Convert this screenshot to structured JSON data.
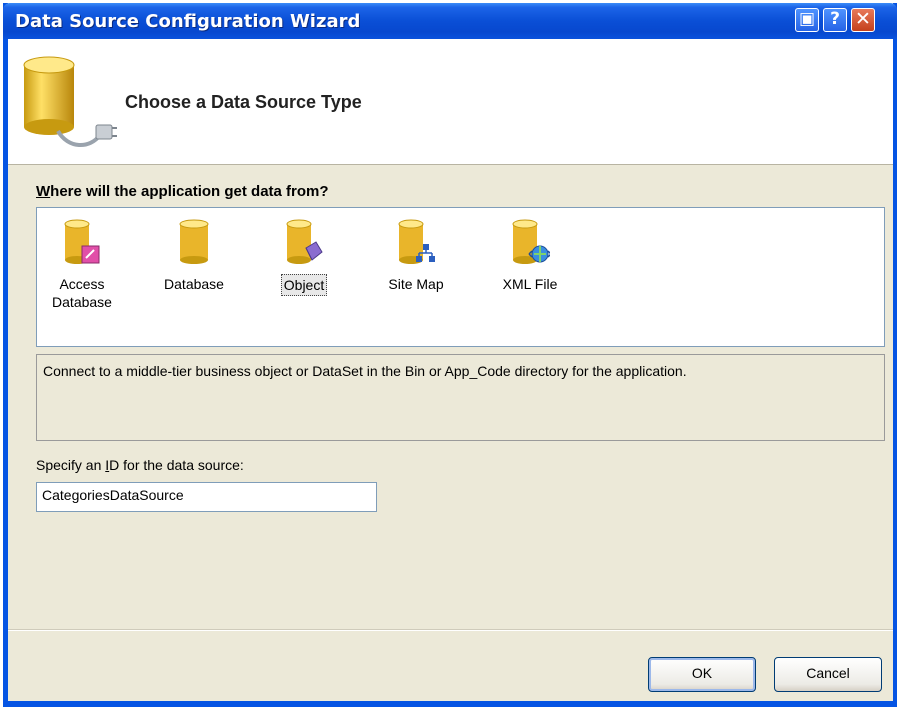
{
  "window": {
    "title": "Data Source Configuration Wizard",
    "controls": {
      "system": "▣",
      "help": "?",
      "close": "✕"
    }
  },
  "header": {
    "heading": "Choose a Data Source Type",
    "icon": "database-plug-icon"
  },
  "question": {
    "mnemonic": "W",
    "rest": "here will the application get data from?"
  },
  "sources": [
    {
      "label": "Access Database",
      "icon": "access-database-icon",
      "selected": false
    },
    {
      "label": "Database",
      "icon": "database-icon",
      "selected": false
    },
    {
      "label": "Object",
      "icon": "object-icon",
      "selected": true
    },
    {
      "label": "Site Map",
      "icon": "site-map-icon",
      "selected": false
    },
    {
      "label": "XML File",
      "icon": "xml-file-icon",
      "selected": false
    }
  ],
  "description": "Connect to a middle-tier business object or DataSet in the Bin or App_Code directory for the application.",
  "id_field": {
    "label_before": "Specify an ",
    "label_mnemonic": "I",
    "label_after": "D for the data source:",
    "value": "CategoriesDataSource"
  },
  "buttons": {
    "ok": "OK",
    "cancel": "Cancel"
  },
  "colors": {
    "titlebar": "#0a4fd6",
    "dialog_bg": "#ece9d8",
    "close_button": "#c4401c"
  }
}
